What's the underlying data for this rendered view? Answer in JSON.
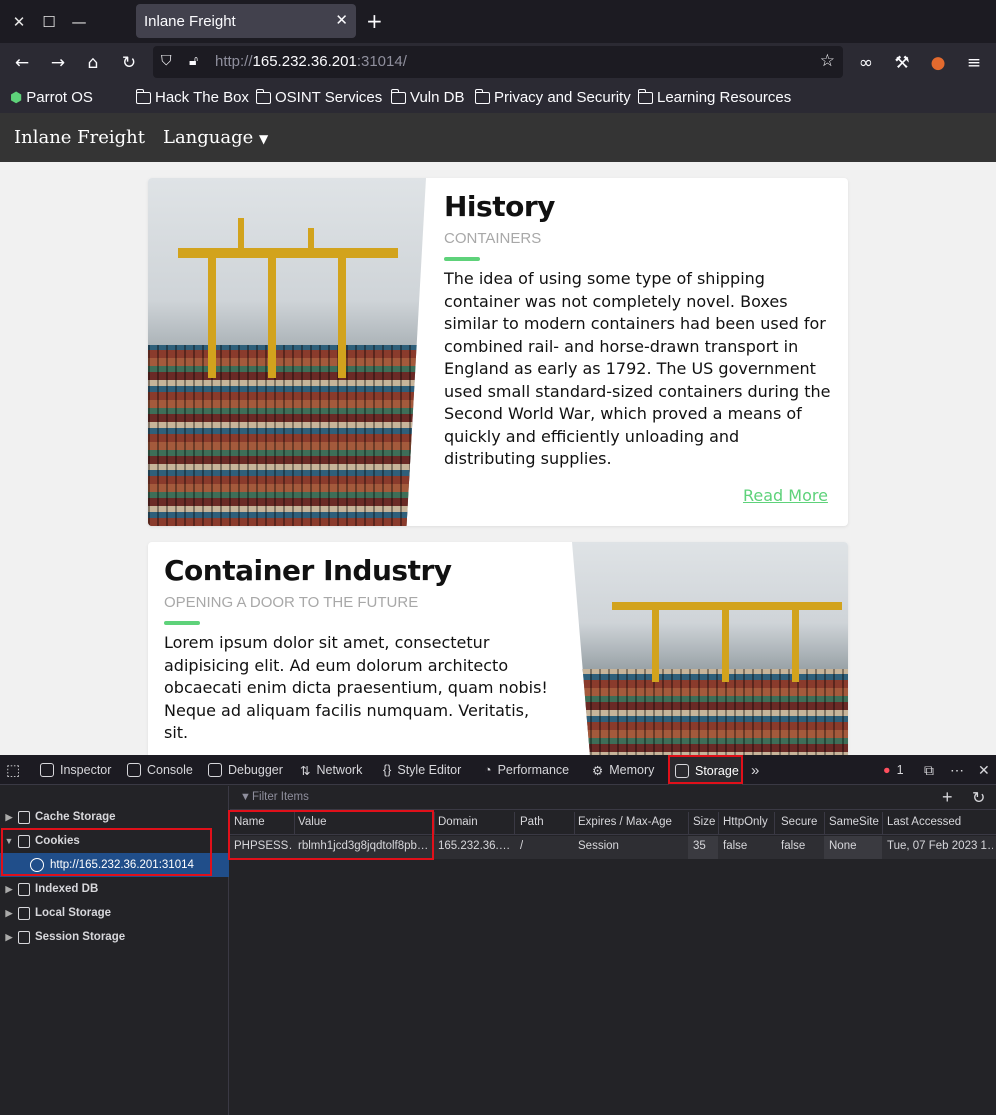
{
  "browser": {
    "tab_title": "Inlane Freight",
    "url_prefix": "http://",
    "url_host": "165.232.36.201",
    "url_port": ":31014/"
  },
  "bookmarks": [
    "Parrot OS",
    "Hack The Box",
    "OSINT Services",
    "Vuln DB",
    "Privacy and Security",
    "Learning Resources"
  ],
  "site": {
    "brand": "Inlane Freight",
    "language": "Language"
  },
  "cards": [
    {
      "title": "History",
      "subtitle": "CONTAINERS",
      "body_lines": [
        "The idea of using some type of shipping",
        "container was not completely novel. Boxes",
        "similar to modern containers had been used for",
        "combined rail- and horse-drawn transport in",
        "England as early as 1792. The US government",
        "used small standard-sized containers during the",
        "Second World War, which proved a means of",
        "quickly and efficiently unloading and",
        "distributing supplies."
      ],
      "link": "Read More"
    },
    {
      "title": "Container Industry",
      "subtitle": "OPENING A DOOR TO THE FUTURE",
      "body_lines": [
        "Lorem ipsum dolor sit amet, consectetur",
        "adipisicing elit. Ad eum dolorum architecto",
        "obcaecati enim dicta praesentium, quam nobis!",
        "Neque ad aliquam facilis numquam. Veritatis,",
        "sit."
      ]
    }
  ],
  "devtools": {
    "tabs": [
      "Inspector",
      "Console",
      "Debugger",
      "Network",
      "Style Editor",
      "Performance",
      "Memory",
      "Storage"
    ],
    "error_count": "1",
    "sidebar": [
      "Cache Storage",
      "Cookies",
      "http://165.232.36.201:31014",
      "Indexed DB",
      "Local Storage",
      "Session Storage"
    ],
    "filter_placeholder": "Filter Items",
    "columns": [
      "Name",
      "Value",
      "Domain",
      "Path",
      "Expires / Max-Age",
      "Size",
      "HttpOnly",
      "Secure",
      "SameSite",
      "Last Accessed"
    ],
    "row": [
      "PHPSESS…",
      "rblmh1jcd3g8jqdtolf8pb…",
      "165.232.36.…",
      "/",
      "Session",
      "35",
      "false",
      "false",
      "None",
      "Tue, 07 Feb 2023 1…"
    ]
  }
}
